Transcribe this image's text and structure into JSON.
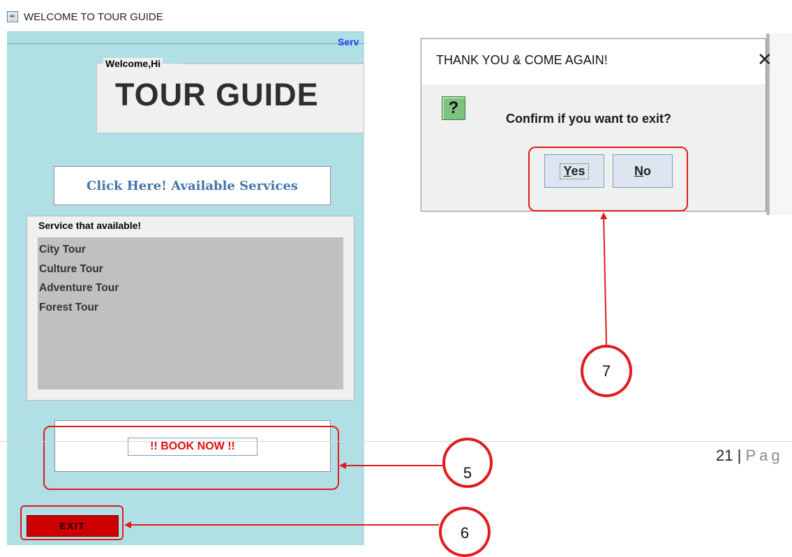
{
  "window": {
    "title": "WELCOME TO TOUR GUIDE",
    "icon": "java-coffee-icon"
  },
  "app": {
    "top_right_label": "Serv",
    "welcome_legend": "Welcome,Hi",
    "main_title": "TOUR GUIDE",
    "available_button": "Click Here! Available Services",
    "services_legend": "Service that available!",
    "services": [
      "City Tour",
      "Culture Tour",
      "Adventure Tour",
      "Forest Tour"
    ],
    "book_button": "!! BOOK NOW !!",
    "exit_button": "EXIT",
    "colors": {
      "panel": "#b0dfe5",
      "exit": "#cc0000",
      "book_text": "#e01010",
      "link_text": "#4176a8"
    }
  },
  "dialog": {
    "title": "THANK YOU & COME AGAIN!",
    "close_icon": "close-icon",
    "question_icon": "?",
    "message": "Confirm if you want to exit?",
    "yes_mnemonic": "Y",
    "yes_rest": "es",
    "no_mnemonic": "N",
    "no_rest": "o"
  },
  "callouts": {
    "c5": "5",
    "c6": "6",
    "c7": "7",
    "color": "#e11b1b"
  },
  "footer": {
    "page_number": "21",
    "separator": "|",
    "page_word": "Pag"
  }
}
